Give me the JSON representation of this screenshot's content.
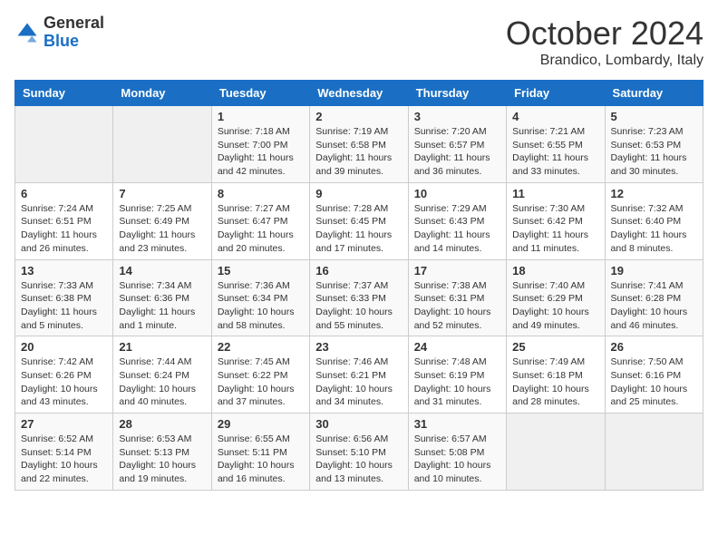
{
  "header": {
    "logo_general": "General",
    "logo_blue": "Blue",
    "month_title": "October 2024",
    "location": "Brandico, Lombardy, Italy"
  },
  "weekdays": [
    "Sunday",
    "Monday",
    "Tuesday",
    "Wednesday",
    "Thursday",
    "Friday",
    "Saturday"
  ],
  "weeks": [
    [
      {
        "day": "",
        "info": ""
      },
      {
        "day": "",
        "info": ""
      },
      {
        "day": "1",
        "info": "Sunrise: 7:18 AM\nSunset: 7:00 PM\nDaylight: 11 hours and 42 minutes."
      },
      {
        "day": "2",
        "info": "Sunrise: 7:19 AM\nSunset: 6:58 PM\nDaylight: 11 hours and 39 minutes."
      },
      {
        "day": "3",
        "info": "Sunrise: 7:20 AM\nSunset: 6:57 PM\nDaylight: 11 hours and 36 minutes."
      },
      {
        "day": "4",
        "info": "Sunrise: 7:21 AM\nSunset: 6:55 PM\nDaylight: 11 hours and 33 minutes."
      },
      {
        "day": "5",
        "info": "Sunrise: 7:23 AM\nSunset: 6:53 PM\nDaylight: 11 hours and 30 minutes."
      }
    ],
    [
      {
        "day": "6",
        "info": "Sunrise: 7:24 AM\nSunset: 6:51 PM\nDaylight: 11 hours and 26 minutes."
      },
      {
        "day": "7",
        "info": "Sunrise: 7:25 AM\nSunset: 6:49 PM\nDaylight: 11 hours and 23 minutes."
      },
      {
        "day": "8",
        "info": "Sunrise: 7:27 AM\nSunset: 6:47 PM\nDaylight: 11 hours and 20 minutes."
      },
      {
        "day": "9",
        "info": "Sunrise: 7:28 AM\nSunset: 6:45 PM\nDaylight: 11 hours and 17 minutes."
      },
      {
        "day": "10",
        "info": "Sunrise: 7:29 AM\nSunset: 6:43 PM\nDaylight: 11 hours and 14 minutes."
      },
      {
        "day": "11",
        "info": "Sunrise: 7:30 AM\nSunset: 6:42 PM\nDaylight: 11 hours and 11 minutes."
      },
      {
        "day": "12",
        "info": "Sunrise: 7:32 AM\nSunset: 6:40 PM\nDaylight: 11 hours and 8 minutes."
      }
    ],
    [
      {
        "day": "13",
        "info": "Sunrise: 7:33 AM\nSunset: 6:38 PM\nDaylight: 11 hours and 5 minutes."
      },
      {
        "day": "14",
        "info": "Sunrise: 7:34 AM\nSunset: 6:36 PM\nDaylight: 11 hours and 1 minute."
      },
      {
        "day": "15",
        "info": "Sunrise: 7:36 AM\nSunset: 6:34 PM\nDaylight: 10 hours and 58 minutes."
      },
      {
        "day": "16",
        "info": "Sunrise: 7:37 AM\nSunset: 6:33 PM\nDaylight: 10 hours and 55 minutes."
      },
      {
        "day": "17",
        "info": "Sunrise: 7:38 AM\nSunset: 6:31 PM\nDaylight: 10 hours and 52 minutes."
      },
      {
        "day": "18",
        "info": "Sunrise: 7:40 AM\nSunset: 6:29 PM\nDaylight: 10 hours and 49 minutes."
      },
      {
        "day": "19",
        "info": "Sunrise: 7:41 AM\nSunset: 6:28 PM\nDaylight: 10 hours and 46 minutes."
      }
    ],
    [
      {
        "day": "20",
        "info": "Sunrise: 7:42 AM\nSunset: 6:26 PM\nDaylight: 10 hours and 43 minutes."
      },
      {
        "day": "21",
        "info": "Sunrise: 7:44 AM\nSunset: 6:24 PM\nDaylight: 10 hours and 40 minutes."
      },
      {
        "day": "22",
        "info": "Sunrise: 7:45 AM\nSunset: 6:22 PM\nDaylight: 10 hours and 37 minutes."
      },
      {
        "day": "23",
        "info": "Sunrise: 7:46 AM\nSunset: 6:21 PM\nDaylight: 10 hours and 34 minutes."
      },
      {
        "day": "24",
        "info": "Sunrise: 7:48 AM\nSunset: 6:19 PM\nDaylight: 10 hours and 31 minutes."
      },
      {
        "day": "25",
        "info": "Sunrise: 7:49 AM\nSunset: 6:18 PM\nDaylight: 10 hours and 28 minutes."
      },
      {
        "day": "26",
        "info": "Sunrise: 7:50 AM\nSunset: 6:16 PM\nDaylight: 10 hours and 25 minutes."
      }
    ],
    [
      {
        "day": "27",
        "info": "Sunrise: 6:52 AM\nSunset: 5:14 PM\nDaylight: 10 hours and 22 minutes."
      },
      {
        "day": "28",
        "info": "Sunrise: 6:53 AM\nSunset: 5:13 PM\nDaylight: 10 hours and 19 minutes."
      },
      {
        "day": "29",
        "info": "Sunrise: 6:55 AM\nSunset: 5:11 PM\nDaylight: 10 hours and 16 minutes."
      },
      {
        "day": "30",
        "info": "Sunrise: 6:56 AM\nSunset: 5:10 PM\nDaylight: 10 hours and 13 minutes."
      },
      {
        "day": "31",
        "info": "Sunrise: 6:57 AM\nSunset: 5:08 PM\nDaylight: 10 hours and 10 minutes."
      },
      {
        "day": "",
        "info": ""
      },
      {
        "day": "",
        "info": ""
      }
    ]
  ]
}
